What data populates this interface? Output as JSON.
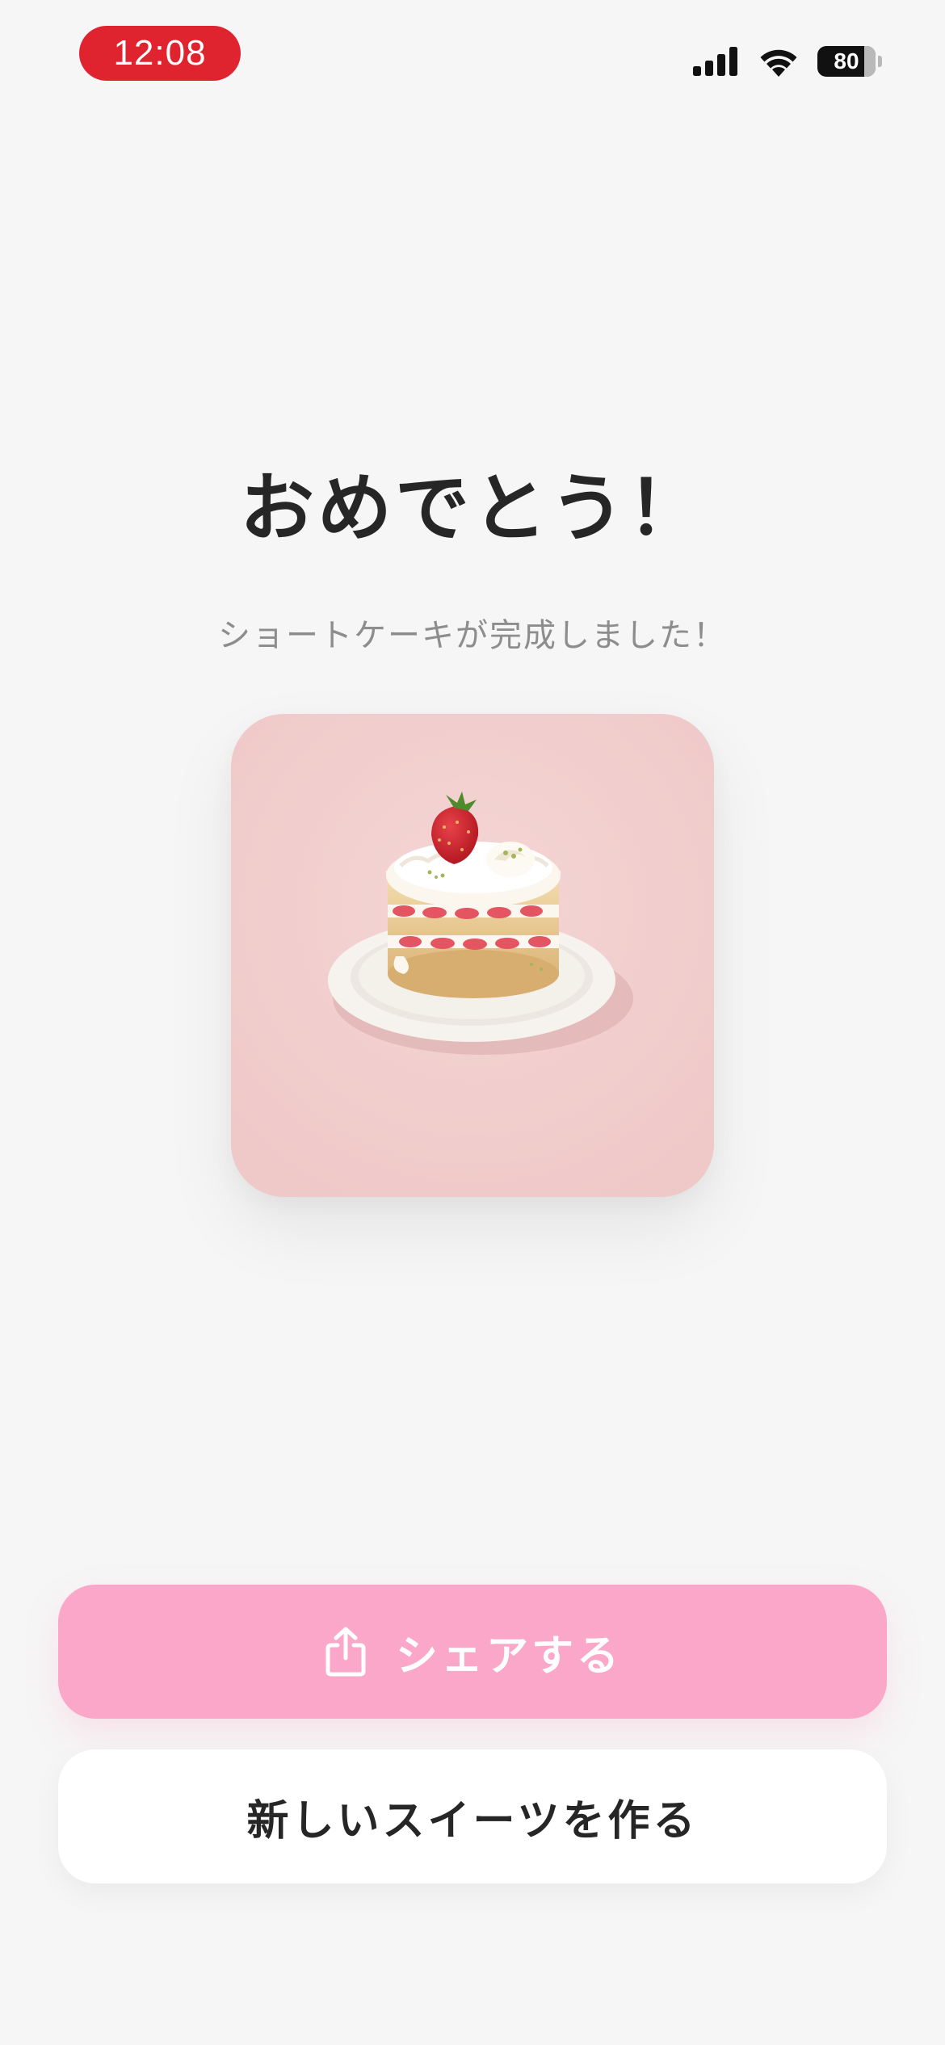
{
  "status_bar": {
    "time": "12:08",
    "battery_level": "80",
    "icons": [
      "cellular-signal-icon",
      "wifi-icon",
      "battery-icon"
    ]
  },
  "result": {
    "headline": "おめでとう！",
    "subtitle": "ショートケーキが完成しました！",
    "image": "strawberry-shortcake-image"
  },
  "actions": {
    "share_label": "シェアする",
    "share_icon": "share-icon",
    "new_label": "新しいスイーツを作る"
  },
  "colors": {
    "time_pill": "#e0242f",
    "share_button": "#fba7c9",
    "background": "#f6f6f6",
    "image_background": "#f1cfcf"
  }
}
